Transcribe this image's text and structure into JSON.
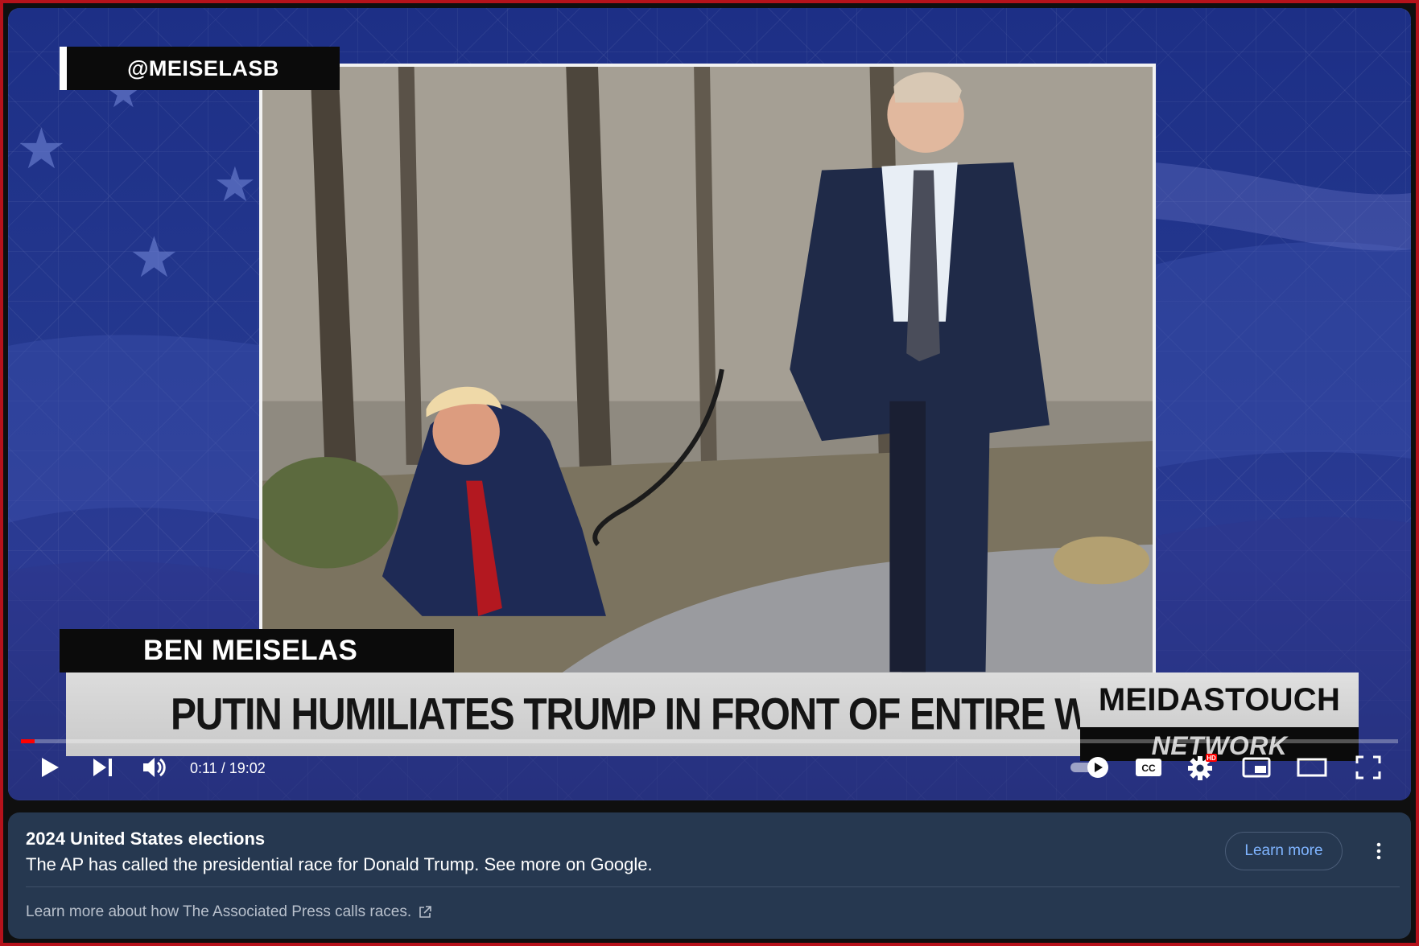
{
  "video": {
    "handle": "@MEISELASB",
    "presenter_name": "BEN MEISELAS",
    "headline": "PUTIN HUMILIATES TRUMP IN FRONT OF ENTIRE WORLD",
    "brand_top": "MEIDASTOUCH",
    "brand_bottom": "NETWORK"
  },
  "controls": {
    "time_display": "0:11 / 19:02",
    "progress_fraction": 0.0097,
    "hd_badge": "HD",
    "icons": [
      "play-icon",
      "next-icon",
      "volume-icon",
      "autoplay-toggle",
      "captions-icon",
      "settings-icon",
      "miniplayer-icon",
      "theater-icon",
      "fullscreen-icon"
    ]
  },
  "info_panel": {
    "title": "2024 United States elections",
    "description": "The AP has called the presidential race for Donald Trump. See more on Google.",
    "learn_more_label": "Learn more",
    "footer_text": "Learn more about how The Associated Press calls races."
  },
  "colors": {
    "progress": "#ff0000",
    "panel_bg": "#263850",
    "link": "#7fb4ff",
    "frame_border": "#b5121b"
  }
}
